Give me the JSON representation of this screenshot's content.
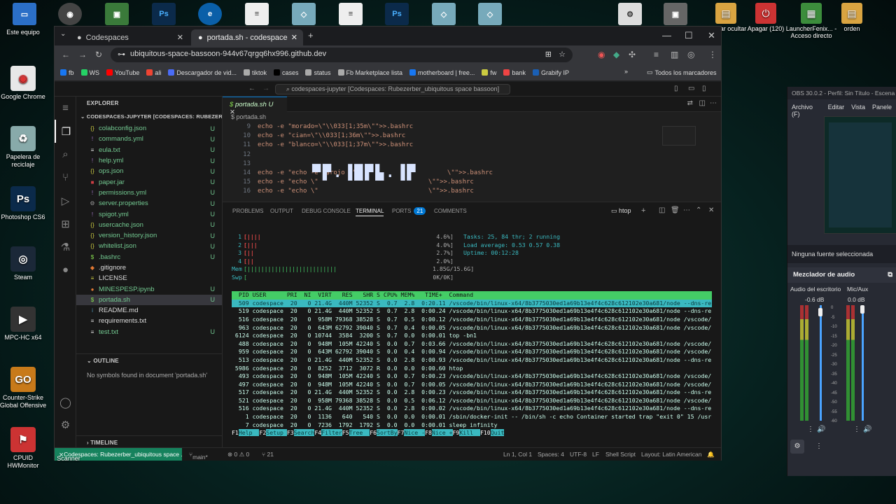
{
  "desktop": {
    "left_icons": [
      {
        "label": "Este equipo",
        "icon": "computer-icon"
      },
      {
        "label": "Google Chrome",
        "icon": "chrome-icon"
      },
      {
        "label": "Papelera de reciclaje",
        "icon": "recycle-bin-icon"
      },
      {
        "label": "Photoshop CS6",
        "icon": "photoshop-icon"
      },
      {
        "label": "Steam",
        "icon": "steam-icon"
      },
      {
        "label": "MPC-HC x64",
        "icon": "mpc-icon"
      },
      {
        "label": "Counter-Strike Global Offensive",
        "icon": "csgo-icon"
      },
      {
        "label": "CPUID HWMonitor",
        "icon": "cpuid-icon"
      }
    ],
    "right_icons": [
      {
        "label": "Ocultar ocultar",
        "icon": "folder-icon"
      },
      {
        "label": "Apagar (120)",
        "icon": "power-icon"
      },
      {
        "label": "LauncherFenix... - Acceso directo",
        "icon": "minecraft-icon"
      },
      {
        "label": "orden",
        "icon": "folder-icon"
      }
    ],
    "partial_labels": [
      "...on culon",
      "directo",
      "Scanner",
      "id"
    ]
  },
  "browser": {
    "tabs": [
      {
        "label": "Codespaces",
        "icon": "github-icon"
      },
      {
        "label": "portada.sh - codespaces-jupyte",
        "icon": "github-icon"
      }
    ],
    "url": "ubiquitous-space-bassoon-944v67qrgq6hx996.github.dev",
    "bookmarks": [
      "fb",
      "WS",
      "YouTube",
      "ali",
      "Descargador de vid...",
      "tiktok",
      "cases",
      "status",
      "Fb Marketplace lista",
      "motherboard | free...",
      "fw",
      "bank",
      "Grabify IP"
    ],
    "all_bookmarks": "Todos los marcadores"
  },
  "vscode": {
    "command_center": "codespaces-jupyter [Codespaces: Rubezerber_ubiquitous space bassoon]",
    "explorer_title": "EXPLORER",
    "workspace": "CODESPACES-JUPYTER [CODESPACES: RUBEZERBER...",
    "files": [
      {
        "name": "colabconfig.json",
        "icon": "{}",
        "color": "#cbcb41",
        "status": "U"
      },
      {
        "name": "commands.yml",
        "icon": "!",
        "color": "#a074c4",
        "status": "U"
      },
      {
        "name": "eula.txt",
        "icon": "≡",
        "color": "#ddd",
        "status": "U"
      },
      {
        "name": "help.yml",
        "icon": "!",
        "color": "#a074c4",
        "status": "U"
      },
      {
        "name": "ops.json",
        "icon": "{}",
        "color": "#cbcb41",
        "status": "U"
      },
      {
        "name": "paper.jar",
        "icon": "■",
        "color": "#cc3e44",
        "status": "U"
      },
      {
        "name": "permissions.yml",
        "icon": "!",
        "color": "#a074c4",
        "status": "U"
      },
      {
        "name": "server.properties",
        "icon": "⚙",
        "color": "#999",
        "status": "U"
      },
      {
        "name": "spigot.yml",
        "icon": "!",
        "color": "#a074c4",
        "status": "U"
      },
      {
        "name": "usercache.json",
        "icon": "{}",
        "color": "#cbcb41",
        "status": "U"
      },
      {
        "name": "version_history.json",
        "icon": "{}",
        "color": "#cbcb41",
        "status": "U"
      },
      {
        "name": "whitelist.json",
        "icon": "{}",
        "color": "#cbcb41",
        "status": "U"
      },
      {
        "name": ".bashrc",
        "icon": "$",
        "color": "#89e051",
        "status": "U"
      },
      {
        "name": ".gitignore",
        "icon": "◆",
        "color": "#e37933",
        "status": ""
      },
      {
        "name": "LICENSE",
        "icon": "≡",
        "color": "#cbcb41",
        "status": ""
      },
      {
        "name": "MINESPESP.ipynb",
        "icon": "●",
        "color": "#e37933",
        "status": "U"
      },
      {
        "name": "portada.sh",
        "icon": "$",
        "color": "#89e051",
        "status": "U"
      },
      {
        "name": "README.md",
        "icon": "i",
        "color": "#519aba",
        "status": ""
      },
      {
        "name": "requirements.txt",
        "icon": "≡",
        "color": "#ddd",
        "status": ""
      },
      {
        "name": "test.txt",
        "icon": "≡",
        "color": "#ddd",
        "status": "U"
      }
    ],
    "outline_title": "OUTLINE",
    "outline_empty": "No symbols found in document 'portada.sh'",
    "timeline_title": "TIMELINE",
    "editor_tab": "portada.sh U",
    "breadcrumb": "$ portada.sh",
    "code_lines": [
      {
        "n": "9",
        "text": "echo -e \"morado=\\\"\\\\033[1;35m\\\"\">>.bashrc"
      },
      {
        "n": "10",
        "text": "echo -e \"cian=\\\"\\\\033[1;36m\\\"\">>.bashrc"
      },
      {
        "n": "11",
        "text": "echo -e \"blanco=\\\"\\\\033[1;37m\\\"\">>.bashrc"
      },
      {
        "n": "12",
        "text": ""
      },
      {
        "n": "13",
        "text": ""
      },
      {
        "n": "14",
        "text": "echo -e \"echo -e \\$rojo \\\"                        \\\"\">>.bashrc"
      },
      {
        "n": "15",
        "text": "echo -e \"echo \\\"                             \\\"\">>.bashrc"
      },
      {
        "n": "16",
        "text": "echo -e \"echo \\\"                             \\\"\">>.bashrc"
      }
    ],
    "panel_tabs": [
      "PROBLEMS",
      "OUTPUT",
      "DEBUG CONSOLE",
      "TERMINAL",
      "PORTS",
      "COMMENTS"
    ],
    "ports_count": "21",
    "terminal_name": "htop",
    "status": {
      "remote": "Codespaces: Rubezerber_ubiquitous space ...",
      "branch": "main*",
      "problems": "⊗ 0 ⚠ 0",
      "ports": "⑂ 21",
      "position": "Ln 1, Col 1",
      "spaces": "Spaces: 4",
      "encoding": "UTF-8",
      "eol": "LF",
      "language": "Shell Script",
      "layout": "Layout: Latin American"
    }
  },
  "htop": {
    "cpus": [
      {
        "n": "1",
        "bar": "[||||",
        "pct": "4.6%]"
      },
      {
        "n": "2",
        "bar": "[|||",
        "pct": "4.0%]"
      },
      {
        "n": "3",
        "bar": "[||",
        "pct": "2.7%]"
      },
      {
        "n": "4",
        "bar": "[||",
        "pct": "2.0%]"
      }
    ],
    "mem": {
      "label": "Mem",
      "bar": "[||||||||||||||||||||||||||",
      "value": "1.85G/15.6G]"
    },
    "swp": {
      "label": "Swp",
      "bar": "[",
      "value": "0K/0K]"
    },
    "tasks": "Tasks: 25, 84 thr; 2 running",
    "load": "Load average: 0.53 0.57 0.38",
    "uptime": "Uptime: 00:12:28",
    "header": "  PID USER      PRI  NI  VIRT   RES   SHR S CPU% MEM%   TIME+  Command",
    "processes": [
      "  509 codespace  20   0 21.4G  440M 52352 S  0.7  2.8  0:20.11 /vscode/bin/linux-x64/8b3775030ed1a69b13e4f4c628c612102e30a681/node --dns-re",
      "  519 codespace  20   0 21.4G  440M 52352 S  0.7  2.8  0:00.24 /vscode/bin/linux-x64/8b3775030ed1a69b13e4f4c628c612102e30a681/node --dns-re",
      "  516 codespace  20   0  958M 79368 38528 S  0.7  0.5  0:00.12 /vscode/bin/linux-x64/8b3775030ed1a69b13e4f4c628c612102e30a681/node /vscode/",
      "  963 codespace  20   0  643M 62792 39040 S  0.7  0.4  0:00.05 /vscode/bin/linux-x64/8b3775030ed1a69b13e4f4c628c612102e30a681/node /vscode/",
      " 6124 codespace  20   0 10744  3584  3200 S  0.7  0.0  0:00.01 top -bn1",
      "  488 codespace  20   0  948M  105M 42240 S  0.0  0.7  0:03.66 /vscode/bin/linux-x64/8b3775030ed1a69b13e4f4c628c612102e30a681/node /vscode/",
      "  959 codespace  20   0  643M 62792 39040 S  0.0  0.4  0:00.94 /vscode/bin/linux-x64/8b3775030ed1a69b13e4f4c628c612102e30a681/node /vscode/",
      "  513 codespace  20   0 21.4G  440M 52352 S  0.0  2.8  0:00.93 /vscode/bin/linux-x64/8b3775030ed1a69b13e4f4c628c612102e30a681/node --dns-re",
      " 5986 codespace  20   0  8252  3712  3072 R  0.0  0.0  0:00.60 htop",
      "  493 codespace  20   0  948M  105M 42240 S  0.0  0.7  0:00.23 /vscode/bin/linux-x64/8b3775030ed1a69b13e4f4c628c612102e30a681/node /vscode/",
      "  497 codespace  20   0  948M  105M 42240 S  0.0  0.7  0:00.05 /vscode/bin/linux-x64/8b3775030ed1a69b13e4f4c628c612102e30a681/node /vscode/",
      "  517 codespace  20   0 21.4G  440M 52352 S  0.0  2.8  0:00.23 /vscode/bin/linux-x64/8b3775030ed1a69b13e4f4c628c612102e30a681/node --dns-re",
      "  521 codespace  20   0  958M 79368 38528 S  0.0  0.5  0:06.12 /vscode/bin/linux-x64/8b3775030ed1a69b13e4f4c628c612102e30a681/node /vscode/",
      "  516 codespace  20   0 21.4G  440M 52352 S  0.0  2.8  0:00.02 /vscode/bin/linux-x64/8b3775030ed1a69b13e4f4c628c612102e30a681/node --dns-re",
      "    1 codespace  20   0  1136   640   540 S  0.0  0.0  0:00.01 /sbin/docker-init -- /bin/sh -c echo Container started trap \"exit 0\" 15 /usr",
      "    7 codespace  20   0  7236  1792  1792 S  0.0  0.0  0:00.01 sleep infinity"
    ],
    "fkeys": [
      {
        "k": "F1",
        "d": "Help  "
      },
      {
        "k": "F2",
        "d": "Setup "
      },
      {
        "k": "F3",
        "d": "Search"
      },
      {
        "k": "F4",
        "d": "Filter"
      },
      {
        "k": "F5",
        "d": "Tree  "
      },
      {
        "k": "F6",
        "d": "SortBy"
      },
      {
        "k": "F7",
        "d": "Nice -"
      },
      {
        "k": "F8",
        "d": "Nice +"
      },
      {
        "k": "F9",
        "d": "Kill  "
      },
      {
        "k": "F10",
        "d": "Quit"
      }
    ]
  },
  "obs": {
    "title": "OBS 30.0.2 - Perfil: Sin Título - Escena",
    "menu": [
      "Archivo (F)",
      "Editar",
      "Vista",
      "Panele"
    ],
    "no_source": "Ninguna fuente seleccionada",
    "mixer_title": "Mezclador de audio",
    "channels": [
      {
        "name": "Audio del escritorio",
        "db": "-0.6 dB"
      },
      {
        "name": "Mic/Aux",
        "db": "0.0 dB"
      }
    ],
    "scale": [
      "0",
      "-5",
      "-10",
      "-15",
      "-20",
      "-25",
      "-30",
      "-35",
      "-40",
      "-45",
      "-50",
      "-55",
      "-60"
    ]
  },
  "colors": {
    "terminal_header": "#44cc66",
    "terminal_highlight": "#3ab9c0",
    "vscode_remote": "#16825d"
  }
}
